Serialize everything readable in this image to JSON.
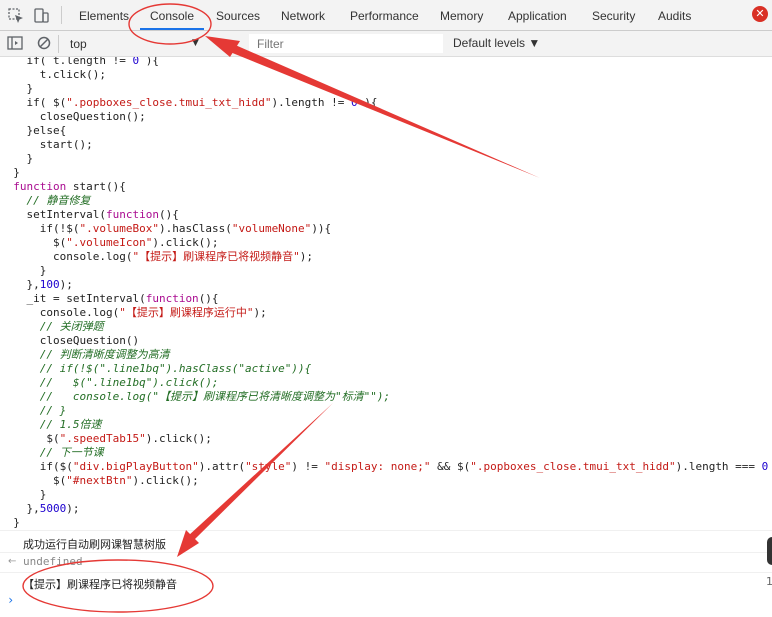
{
  "tabs": [
    "Elements",
    "Console",
    "Sources",
    "Network",
    "Performance",
    "Memory",
    "Application",
    "Security",
    "Audits"
  ],
  "active_tab": "Console",
  "close_badge": "✕",
  "toolbar": {
    "context": "top",
    "context_arrow": "▼",
    "filter_placeholder": "Filter",
    "levels": "Default levels ▼"
  },
  "code_lines": [
    [
      [
        "    if( t.length != ",
        ""
      ],
      [
        "0",
        "num"
      ],
      [
        " ){",
        ""
      ]
    ],
    [
      [
        "      t.click();",
        ""
      ]
    ],
    [
      [
        "    }",
        ""
      ]
    ],
    [
      [
        "    if( $(",
        ""
      ],
      [
        "\".popboxes_close.tmui_txt_hidd\"",
        "str"
      ],
      [
        ").length != ",
        ""
      ],
      [
        "0",
        "num"
      ],
      [
        " ){",
        ""
      ]
    ],
    [
      [
        "      closeQuestion();",
        ""
      ]
    ],
    [
      [
        "    }else{",
        ""
      ]
    ],
    [
      [
        "      start();",
        ""
      ]
    ],
    [
      [
        "    }",
        ""
      ]
    ],
    [
      [
        "  }",
        ""
      ]
    ],
    [
      [
        "  ",
        ""
      ],
      [
        "function",
        "kw"
      ],
      [
        " start(){",
        ""
      ]
    ],
    [
      [
        "    ",
        ""
      ],
      [
        "// 静音修复",
        "cm"
      ]
    ],
    [
      [
        "    setInterval(",
        ""
      ],
      [
        "function",
        "kw"
      ],
      [
        "(){",
        ""
      ]
    ],
    [
      [
        "      if(!$(",
        ""
      ],
      [
        "\".volumeBox\"",
        "str"
      ],
      [
        ").hasClass(",
        ""
      ],
      [
        "\"volumeNone\"",
        "str"
      ],
      [
        ")){",
        ""
      ]
    ],
    [
      [
        "        $(",
        ""
      ],
      [
        "\".volumeIcon\"",
        "str"
      ],
      [
        ").click();",
        ""
      ]
    ],
    [
      [
        "        console.log(",
        ""
      ],
      [
        "\"【提示】刷课程序已将视频静音\"",
        "str"
      ],
      [
        ");",
        ""
      ]
    ],
    [
      [
        "      }",
        ""
      ]
    ],
    [
      [
        "    },",
        ""
      ],
      [
        "100",
        "num"
      ],
      [
        ");",
        ""
      ]
    ],
    [
      [
        "    _it = setInterval(",
        ""
      ],
      [
        "function",
        "kw"
      ],
      [
        "(){",
        ""
      ]
    ],
    [
      [
        "      console.log(",
        ""
      ],
      [
        "\"【提示】刷课程序运行中\"",
        "str"
      ],
      [
        ");",
        ""
      ]
    ],
    [
      [
        "      ",
        ""
      ],
      [
        "// 关闭弹题",
        "cm"
      ]
    ],
    [
      [
        "      closeQuestion()",
        ""
      ]
    ],
    [
      [
        "      ",
        ""
      ],
      [
        "// 判断清晰度调整为高清",
        "cm"
      ]
    ],
    [
      [
        "      ",
        ""
      ],
      [
        "// if(!$(\".line1bq\").hasClass(\"active\")){",
        "cm"
      ]
    ],
    [
      [
        "      ",
        ""
      ],
      [
        "//   $(\".line1bq\").click();",
        "cm"
      ]
    ],
    [
      [
        "      ",
        ""
      ],
      [
        "//   console.log(\"【提示】刷课程序已将清晰度调整为\"标清\"\");",
        "cm"
      ]
    ],
    [
      [
        "      ",
        ""
      ],
      [
        "// }",
        "cm"
      ]
    ],
    [
      [
        "      ",
        ""
      ],
      [
        "// 1.5倍速",
        "cm"
      ]
    ],
    [
      [
        "       $(",
        ""
      ],
      [
        "\".speedTab15\"",
        "str"
      ],
      [
        ").click();",
        ""
      ]
    ],
    [
      [
        "      ",
        ""
      ],
      [
        "// 下一节课",
        "cm"
      ]
    ],
    [
      [
        "      if($(",
        ""
      ],
      [
        "\"div.bigPlayButton\"",
        "str"
      ],
      [
        ").attr(",
        ""
      ],
      [
        "\"style\"",
        "str"
      ],
      [
        ") != ",
        ""
      ],
      [
        "\"display: none;\"",
        "str"
      ],
      [
        " && $(",
        ""
      ],
      [
        "\".popboxes_close.tmui_txt_hidd\"",
        "str"
      ],
      [
        ").length === ",
        ""
      ],
      [
        "0",
        "num"
      ]
    ],
    [
      [
        "        $(",
        ""
      ],
      [
        "\"#nextBtn\"",
        "str"
      ],
      [
        ").click();",
        ""
      ]
    ],
    [
      [
        "      }",
        ""
      ]
    ],
    [
      [
        "    },",
        ""
      ],
      [
        "5000",
        "num"
      ],
      [
        ");",
        ""
      ]
    ],
    [
      [
        "  }",
        ""
      ]
    ]
  ],
  "console_messages": {
    "log1": "成功运行自动刷网课智慧树版",
    "return_arrow": "←",
    "return_value": "undefined",
    "log2": "【提示】刷课程序已将视频静音",
    "prompt_symbol": "›",
    "right_mark": "1"
  },
  "annotation_color": "#e53935"
}
